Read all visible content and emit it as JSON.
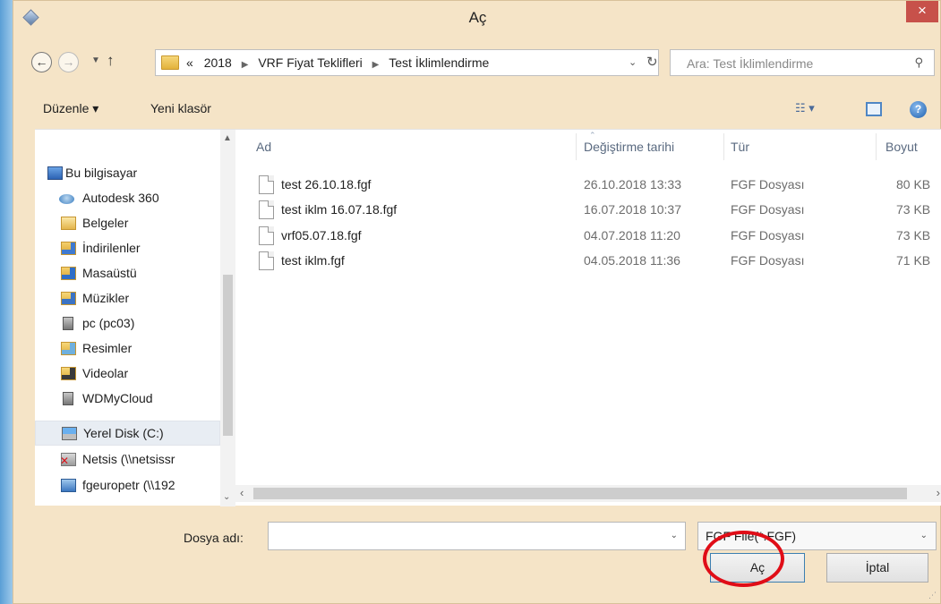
{
  "window": {
    "title": "Aç",
    "close_label": "×"
  },
  "nav": {
    "back_glyph": "←",
    "forward_glyph": "→",
    "recent_glyph": "▼",
    "up_glyph": "↑",
    "breadcrumb": [
      "«",
      "2018",
      "VRF Fiyat Teklifleri",
      "Test İklimlendirme"
    ],
    "breadcrumb_sep": "▶",
    "dropdown_glyph": "⌄",
    "refresh_glyph": "↻",
    "search_placeholder": "Ara: Test İklimlendirme",
    "search_glyph": "⚲"
  },
  "toolbar": {
    "organize_label": "Düzenle ▾",
    "new_folder_label": "Yeni klasör",
    "view_glyph": "☷ ▾",
    "help_glyph": "?"
  },
  "nav_pane": {
    "items": [
      {
        "label": "Bu bilgisayar",
        "icon": "computer-icon"
      },
      {
        "label": "Autodesk 360",
        "icon": "cloud-icon"
      },
      {
        "label": "Belgeler",
        "icon": "documents-folder-icon"
      },
      {
        "label": "İndirilenler",
        "icon": "downloads-folder-icon"
      },
      {
        "label": "Masaüstü",
        "icon": "desktop-folder-icon"
      },
      {
        "label": "Müzikler",
        "icon": "music-folder-icon"
      },
      {
        "label": "pc (pc03)",
        "icon": "network-computer-icon"
      },
      {
        "label": "Resimler",
        "icon": "pictures-folder-icon"
      },
      {
        "label": "Videolar",
        "icon": "videos-folder-icon"
      },
      {
        "label": "WDMyCloud",
        "icon": "network-computer-icon"
      },
      {
        "label": "Yerel Disk (C:)",
        "icon": "local-disk-icon",
        "selected": true
      },
      {
        "label": "Netsis (\\\\netsissr",
        "icon": "disconnected-drive-icon"
      },
      {
        "label": "fgeuropetr (\\\\192",
        "icon": "network-drive-icon"
      }
    ],
    "scroll_up": "▲",
    "scroll_down": "⌄"
  },
  "files": {
    "columns": {
      "name": "Ad",
      "modified": "Değiştirme tarihi",
      "type": "Tür",
      "size": "Boyut"
    },
    "sort_caret": "⌃",
    "rows": [
      {
        "name": "test 26.10.18.fgf",
        "modified": "26.10.2018 13:33",
        "type": "FGF Dosyası",
        "size": "80 KB"
      },
      {
        "name": "test iklm 16.07.18.fgf",
        "modified": "16.07.2018 10:37",
        "type": "FGF Dosyası",
        "size": "73 KB"
      },
      {
        "name": "vrf05.07.18.fgf",
        "modified": "04.07.2018 11:20",
        "type": "FGF Dosyası",
        "size": "73 KB"
      },
      {
        "name": "test iklm.fgf",
        "modified": "04.05.2018 11:36",
        "type": "FGF Dosyası",
        "size": "71 KB"
      }
    ],
    "hscroll_left": "‹",
    "hscroll_right": "›"
  },
  "bottom": {
    "filename_label": "Dosya adı:",
    "filename_value": "",
    "filename_drop": "⌄",
    "filter_value": "FGF File(*.FGF)",
    "filter_drop": "⌄",
    "open_label": "Aç",
    "cancel_label": "İptal",
    "grip": "⋰"
  },
  "colors": {
    "window_frame": "#f5e4c7",
    "close_button": "#c7514a",
    "annotation_circle": "#e00d17"
  }
}
